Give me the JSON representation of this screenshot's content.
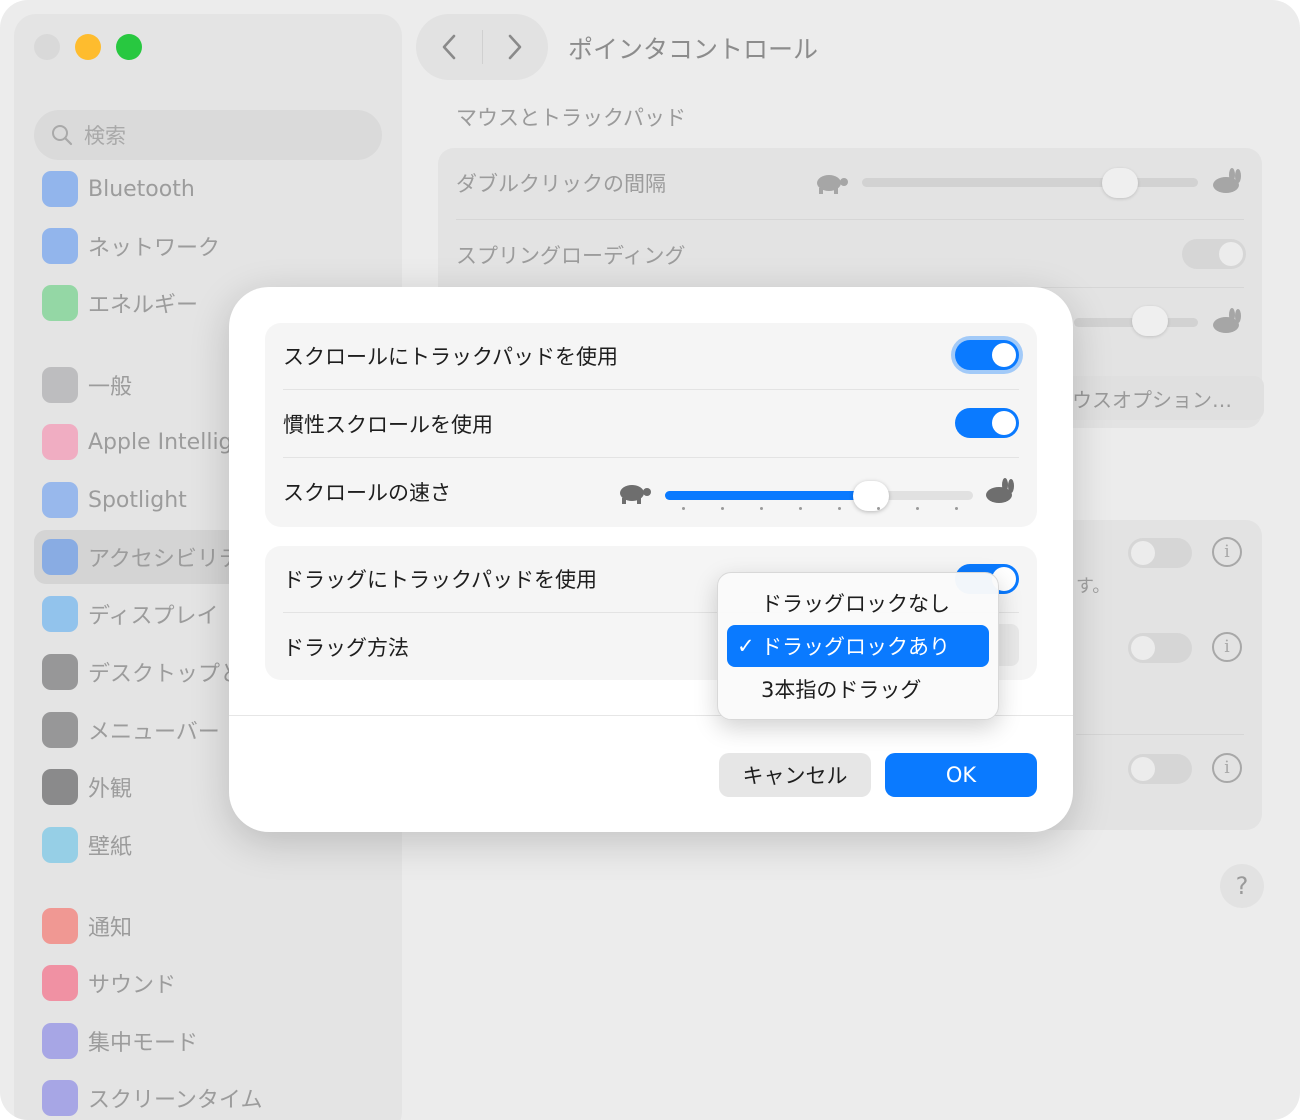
{
  "window": {
    "title": "ポインタコントロール",
    "section_title": "マウスとトラックパッド"
  },
  "search": {
    "placeholder": "検索"
  },
  "sidebar": {
    "items": [
      {
        "label": "Bluetooth",
        "icon": "bluetooth-icon",
        "color": "#2f7cf6"
      },
      {
        "label": "ネットワーク",
        "icon": "globe-icon",
        "color": "#2f7cf6"
      },
      {
        "label": "エネルギー",
        "icon": "bolt-icon",
        "color": "#34c759"
      },
      {
        "label": "一般",
        "icon": "gear-icon",
        "color": "#8e8e93"
      },
      {
        "label": "Apple Intellig",
        "icon": "apple-intelligence-icon",
        "color": "#ff6b9a"
      },
      {
        "label": "Spotlight",
        "icon": "magnifier-icon",
        "color": "#3b82f6"
      },
      {
        "label": "アクセシビリテ",
        "icon": "accessibility-icon",
        "color": "#2f7cf6"
      },
      {
        "label": "ディスプレイ",
        "icon": "sun-icon",
        "color": "#2f9cf6"
      },
      {
        "label": "デスクトップと",
        "icon": "dock-icon",
        "color": "#3a3a3c"
      },
      {
        "label": "メニューバー",
        "icon": "menubar-icon",
        "color": "#3a3a3c"
      },
      {
        "label": "外観",
        "icon": "appearance-icon",
        "color": "#1c1c1e"
      },
      {
        "label": "壁紙",
        "icon": "flower-icon",
        "color": "#37b5e8"
      },
      {
        "label": "通知",
        "icon": "bell-icon",
        "color": "#ff3b30"
      },
      {
        "label": "サウンド",
        "icon": "speaker-icon",
        "color": "#ff2d55"
      },
      {
        "label": "集中モード",
        "icon": "moon-icon",
        "color": "#5e5ce6"
      },
      {
        "label": "スクリーンタイム",
        "icon": "hourglass-icon",
        "color": "#5e5ce6"
      }
    ]
  },
  "background": {
    "double_click_label": "ダブルクリックの間隔",
    "spring_loading_label": "スプリングローディング",
    "mouse_options_label": "ウスオプション…",
    "partial_text": "す。",
    "help_label": "?",
    "info_label": "i"
  },
  "sheet": {
    "scroll_group": {
      "use_trackpad_label": "スクロールにトラックパッドを使用",
      "use_trackpad_on": true,
      "inertia_label": "慣性スクロールを使用",
      "inertia_on": true,
      "speed_label": "スクロールの速さ",
      "speed_value": 0.69
    },
    "drag_group": {
      "use_trackpad_label": "ドラッグにトラックパッドを使用",
      "use_trackpad_on": true,
      "method_label": "ドラッグ方法"
    },
    "cancel_label": "キャンセル",
    "ok_label": "OK"
  },
  "dropdown": {
    "options": [
      "ドラッグロックなし",
      "ドラッグロックあり",
      "3本指のドラッグ"
    ],
    "selected": "ドラッグロックあり",
    "check": "✓"
  },
  "colors": {
    "accent": "#0a7aff"
  }
}
